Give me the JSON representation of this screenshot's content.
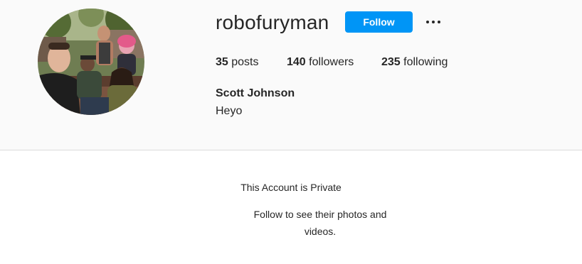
{
  "profile": {
    "username": "robofuryman",
    "follow_label": "Follow",
    "more_icon": "more-options-icon",
    "stats": {
      "posts_count": "35",
      "posts_label": "posts",
      "followers_count": "140",
      "followers_label": "followers",
      "following_count": "235",
      "following_label": "following"
    },
    "full_name": "Scott Johnson",
    "bio": "Heyo"
  },
  "private_notice": {
    "title": "This Account is Private",
    "subtitle": "Follow to see their photos and videos."
  },
  "colors": {
    "follow_button": "#0095f6",
    "header_background": "#fafafa",
    "divider": "#dbdbdb",
    "text": "#262626"
  }
}
